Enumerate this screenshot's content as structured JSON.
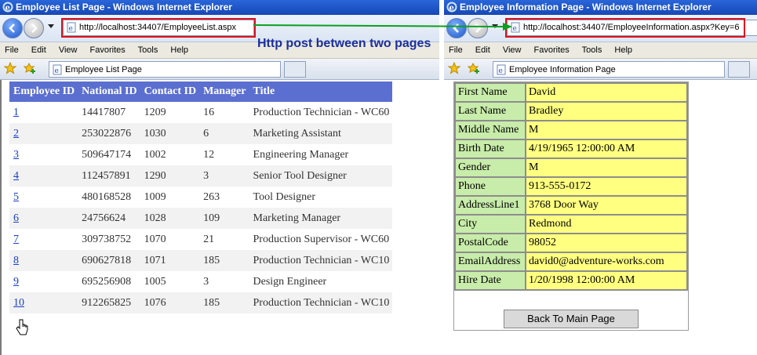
{
  "colors": {
    "accent": "#5b6fd0",
    "label_bg": "#c8ecaa",
    "value_bg": "#ffff80",
    "highlight": "#e0101a",
    "arrow": "#0aa020"
  },
  "left_window": {
    "title": "Employee List Page - Windows Internet Explorer",
    "address": "http://localhost:34407/EmployeeList.aspx",
    "tab": "Employee List Page",
    "menu": [
      "File",
      "Edit",
      "View",
      "Favorites",
      "Tools",
      "Help"
    ],
    "table": {
      "headers": [
        "Employee ID",
        "National ID",
        "Contact ID",
        "Manager",
        "Title"
      ],
      "rows": [
        [
          "1",
          "14417807",
          "1209",
          "16",
          "Production Technician - WC60"
        ],
        [
          "2",
          "253022876",
          "1030",
          "6",
          "Marketing Assistant"
        ],
        [
          "3",
          "509647174",
          "1002",
          "12",
          "Engineering Manager"
        ],
        [
          "4",
          "112457891",
          "1290",
          "3",
          "Senior Tool Designer"
        ],
        [
          "5",
          "480168528",
          "1009",
          "263",
          "Tool Designer"
        ],
        [
          "6",
          "24756624",
          "1028",
          "109",
          "Marketing Manager"
        ],
        [
          "7",
          "309738752",
          "1070",
          "21",
          "Production Supervisor - WC60"
        ],
        [
          "8",
          "690627818",
          "1071",
          "185",
          "Production Technician - WC10"
        ],
        [
          "9",
          "695256908",
          "1005",
          "3",
          "Design Engineer"
        ],
        [
          "10",
          "912265825",
          "1076",
          "185",
          "Production Technician - WC10"
        ]
      ]
    }
  },
  "right_window": {
    "title": "Employee Information Page - Windows Internet Explorer",
    "address": "http://localhost:34407/EmployeeInformation.aspx?Key=6",
    "tab": "Employee Information Page",
    "menu": [
      "File",
      "Edit",
      "View",
      "Favorites",
      "Tools",
      "Help"
    ],
    "details": [
      {
        "label": "First Name",
        "value": "David"
      },
      {
        "label": "Last Name",
        "value": "Bradley"
      },
      {
        "label": "Middle Name",
        "value": "M"
      },
      {
        "label": "Birth Date",
        "value": "4/19/1965 12:00:00 AM"
      },
      {
        "label": "Gender",
        "value": "M"
      },
      {
        "label": "Phone",
        "value": "913-555-0172"
      },
      {
        "label": "AddressLine1",
        "value": "3768 Door Way"
      },
      {
        "label": "City",
        "value": "Redmond"
      },
      {
        "label": "PostalCode",
        "value": "98052"
      },
      {
        "label": "EmailAddress",
        "value": "david0@adventure-works.com"
      },
      {
        "label": "Hire Date",
        "value": "1/20/1998 12:00:00 AM"
      }
    ],
    "back_button": "Back To Main Page"
  },
  "annotation": "Http post between two pages"
}
